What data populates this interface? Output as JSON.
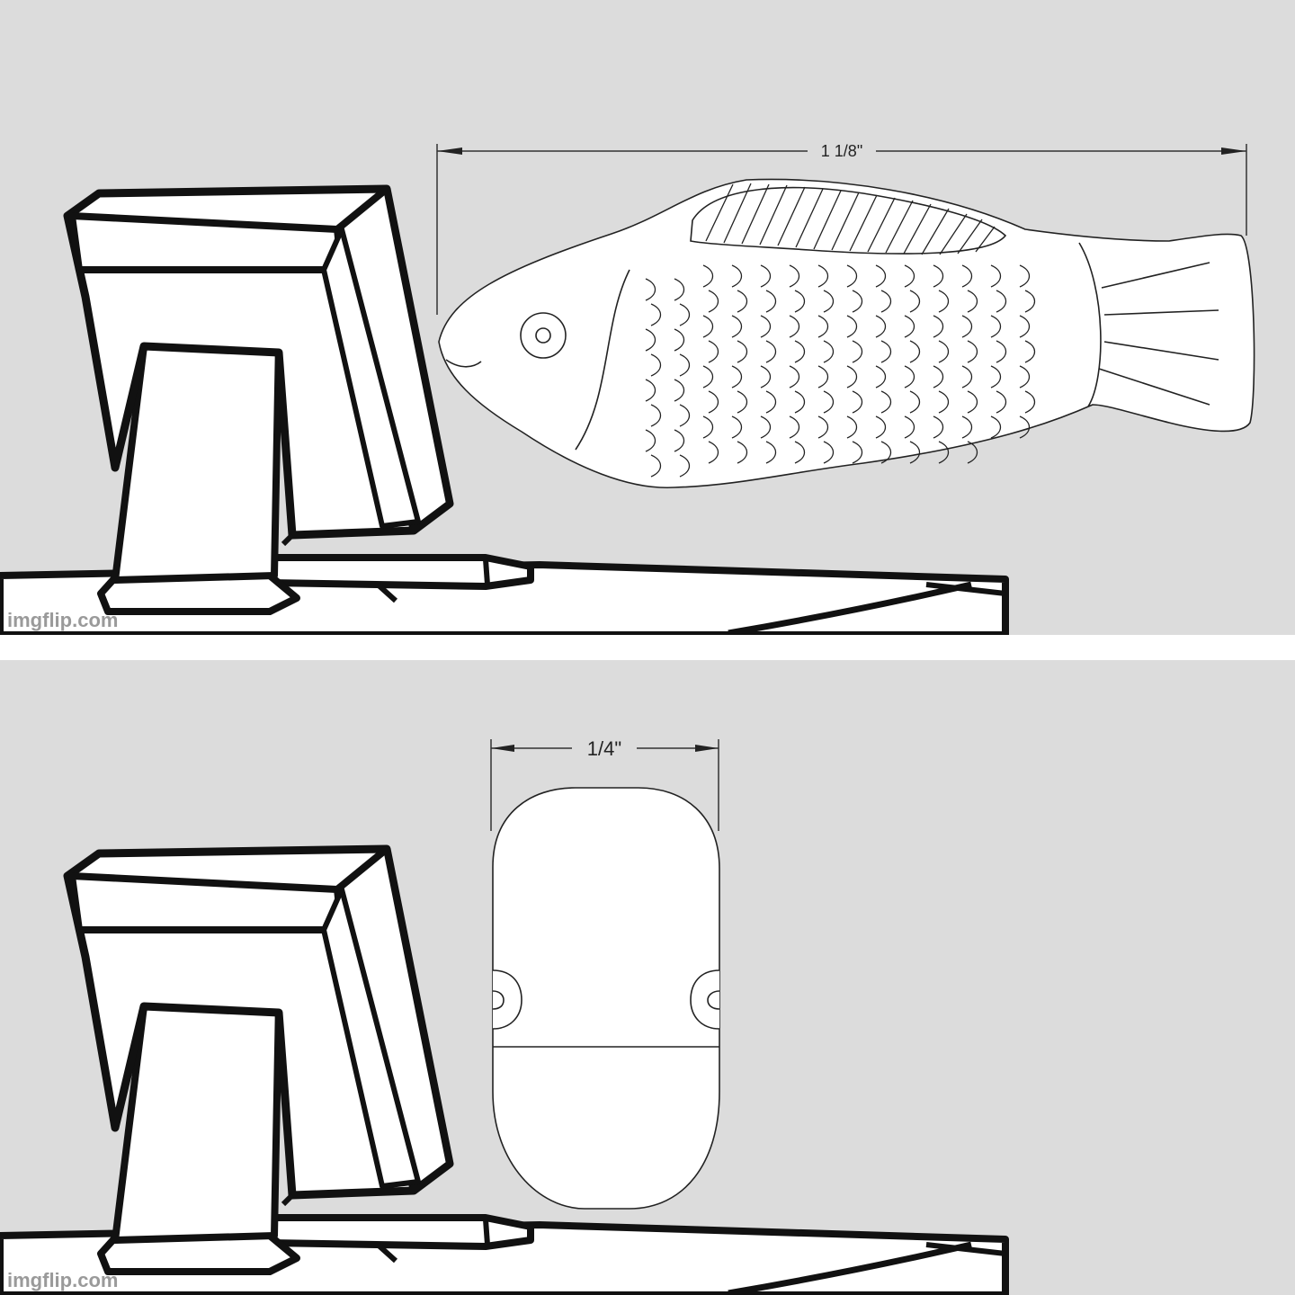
{
  "panels": [
    {
      "subject": "fish-technical-drawing",
      "dimension_label": "1 1/8\"",
      "watermark": "imgflip.com"
    },
    {
      "subject": "fish-end-view-drawing",
      "dimension_label": "1/4\"",
      "watermark": "imgflip.com"
    }
  ],
  "colors": {
    "background": "#dcdcdc",
    "outline": "#111111",
    "fill": "#ffffff",
    "watermark": "#9a9a9a"
  }
}
